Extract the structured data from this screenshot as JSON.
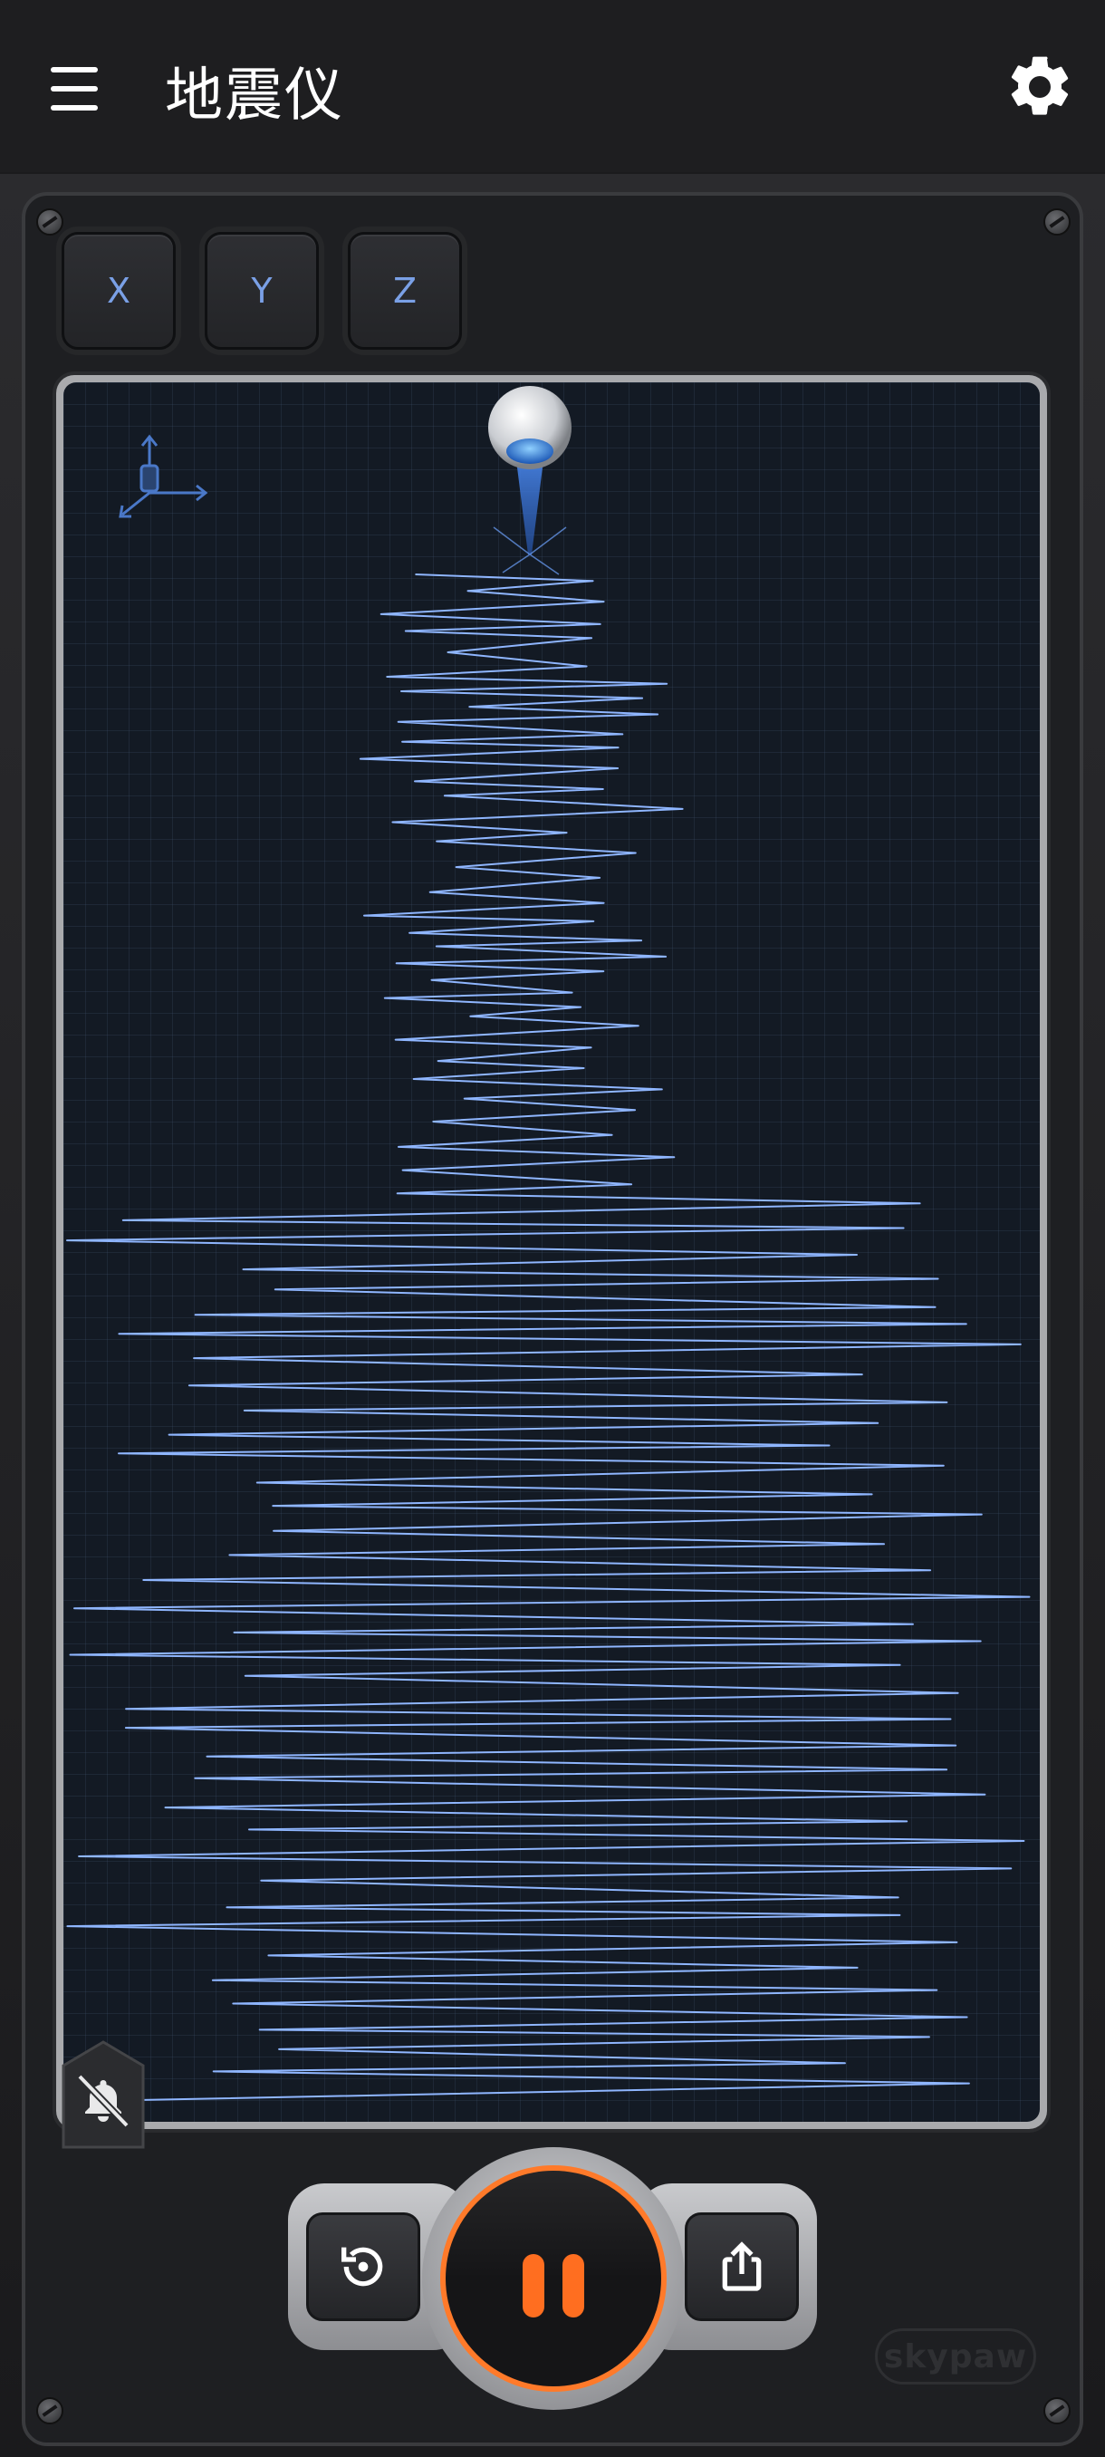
{
  "app": {
    "title": "地震仪",
    "brand": "skypaw"
  },
  "axis_buttons": [
    {
      "label": "X"
    },
    {
      "label": "Y"
    },
    {
      "label": "Z"
    }
  ],
  "colors": {
    "accent": "#ff7a2a",
    "trace": "#8fb6ff",
    "axis_text": "#7aa0e6",
    "background": "#1b1b1d",
    "graph_background": "#131a24"
  },
  "icons": {
    "menu": "hamburger-menu-icon",
    "settings": "gear-icon",
    "axes": "device-axes-icon",
    "alarm": "bell-off-icon",
    "reset": "history-reset-icon",
    "pause": "pause-icon",
    "share": "share-icon"
  },
  "state": {
    "recording": true
  }
}
